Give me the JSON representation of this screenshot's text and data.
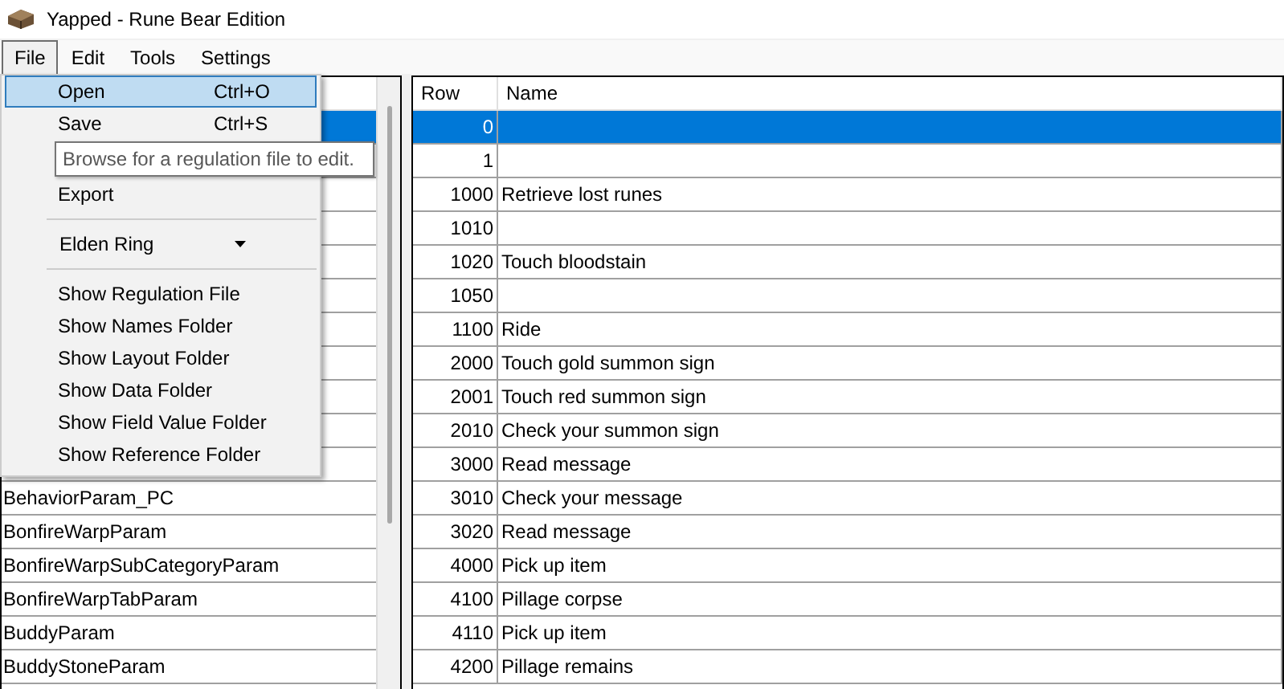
{
  "window": {
    "title": "Yapped - Rune Bear Edition"
  },
  "menu_bar": [
    {
      "label": "File",
      "selected": true
    },
    {
      "label": "Edit",
      "selected": false
    },
    {
      "label": "Tools",
      "selected": false
    },
    {
      "label": "Settings",
      "selected": false
    }
  ],
  "file_menu": {
    "items": [
      {
        "kind": "item",
        "label": "Open",
        "shortcut": "Ctrl+O",
        "selected": true
      },
      {
        "kind": "item",
        "label": "Save",
        "shortcut": "Ctrl+S",
        "selected": false
      },
      {
        "kind": "tooltip",
        "text": "Browse for a regulation file to edit."
      },
      {
        "kind": "item",
        "label": "Export",
        "selected": false
      },
      {
        "kind": "separator"
      },
      {
        "kind": "dropdown",
        "label": "Elden Ring"
      },
      {
        "kind": "separator"
      },
      {
        "kind": "item",
        "label": "Show Regulation File",
        "selected": false
      },
      {
        "kind": "item",
        "label": "Show Names Folder",
        "selected": false
      },
      {
        "kind": "item",
        "label": "Show Layout Folder",
        "selected": false
      },
      {
        "kind": "item",
        "label": "Show Data Folder",
        "selected": false
      },
      {
        "kind": "item",
        "label": "Show Field Value Folder",
        "selected": false
      },
      {
        "kind": "item",
        "label": "Show Reference Folder",
        "selected": false
      }
    ]
  },
  "param_list": {
    "items": [
      {
        "selected": true
      },
      {
        "selected": false
      },
      {
        "selected": false
      },
      {
        "selected": false
      },
      {
        "selected": false
      },
      {
        "selected": false
      },
      {
        "selected": false
      },
      {
        "selected": false
      },
      {
        "selected": false
      },
      {
        "selected": false
      },
      {
        "selected": false
      },
      {
        "name": "BehaviorParam_PC",
        "selected": false
      },
      {
        "name": "BonfireWarpParam",
        "selected": false
      },
      {
        "name": "BonfireWarpSubCategoryParam",
        "selected": false
      },
      {
        "name": "BonfireWarpTabParam",
        "selected": false
      },
      {
        "name": "BuddyParam",
        "selected": false
      },
      {
        "name": "BuddyStoneParam",
        "selected": false
      }
    ]
  },
  "row_table": {
    "columns": [
      "Row",
      "Name"
    ],
    "rows": [
      {
        "row": "0",
        "selected": true
      },
      {
        "row": "1",
        "selected": false
      },
      {
        "row": "1000",
        "name": "Retrieve lost runes",
        "selected": false
      },
      {
        "row": "1010",
        "selected": false
      },
      {
        "row": "1020",
        "name": "Touch bloodstain",
        "selected": false
      },
      {
        "row": "1050",
        "selected": false
      },
      {
        "row": "1100",
        "name": "Ride",
        "selected": false
      },
      {
        "row": "2000",
        "name": "Touch gold summon sign",
        "selected": false
      },
      {
        "row": "2001",
        "name": "Touch red summon sign",
        "selected": false
      },
      {
        "row": "2010",
        "name": "Check your summon sign",
        "selected": false
      },
      {
        "row": "3000",
        "name": "Read message",
        "selected": false
      },
      {
        "row": "3010",
        "name": "Check your message",
        "selected": false
      },
      {
        "row": "3020",
        "name": "Read message",
        "selected": false
      },
      {
        "row": "4000",
        "name": "Pick up item",
        "selected": false
      },
      {
        "row": "4100",
        "name": "Pillage corpse",
        "selected": false
      },
      {
        "row": "4110",
        "name": "Pick up item",
        "selected": false
      },
      {
        "row": "4200",
        "name": "Pillage remains",
        "selected": false
      }
    ]
  }
}
